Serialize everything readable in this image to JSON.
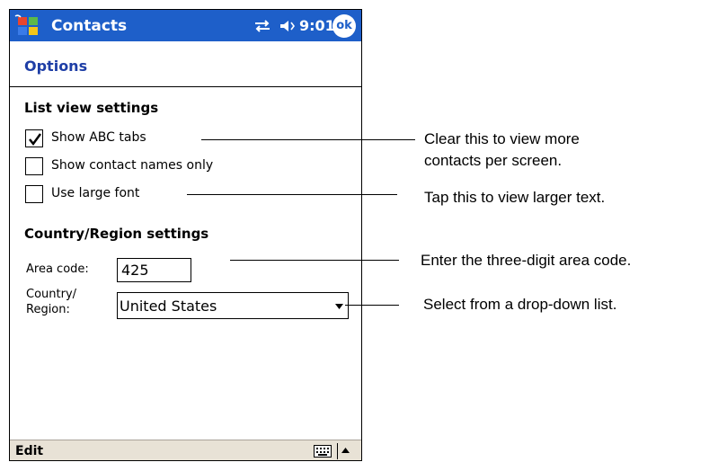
{
  "titlebar": {
    "app_title": "Contacts",
    "clock": "9:01",
    "ok_label": "ok",
    "icons": [
      "start-flag-icon",
      "connectivity-icon",
      "speaker-icon"
    ]
  },
  "page": {
    "title": "Options"
  },
  "list_view": {
    "heading": "List view settings",
    "options": [
      {
        "label": "Show ABC tabs",
        "checked": true
      },
      {
        "label": "Show contact names only",
        "checked": false
      },
      {
        "label": "Use large font",
        "checked": false
      }
    ]
  },
  "region": {
    "heading": "Country/Region settings",
    "area_code_label": "Area code:",
    "area_code_value": "425",
    "country_label_line1": "Country/",
    "country_label_line2": "Region:",
    "country_value": "United States"
  },
  "bottombar": {
    "menu_edit": "Edit",
    "icons": [
      "keyboard-icon",
      "up-arrow-icon"
    ]
  },
  "callouts": {
    "abc_line1": "Clear this to view more",
    "abc_line2": "contacts per screen.",
    "font": "Tap this to view larger text.",
    "area": "Enter the three-digit area code.",
    "country": "Select from a drop-down list."
  },
  "colors": {
    "titlebar": "#1e5fc9",
    "options_title": "#1e3ea6",
    "bottombar": "#e8e2d6"
  }
}
